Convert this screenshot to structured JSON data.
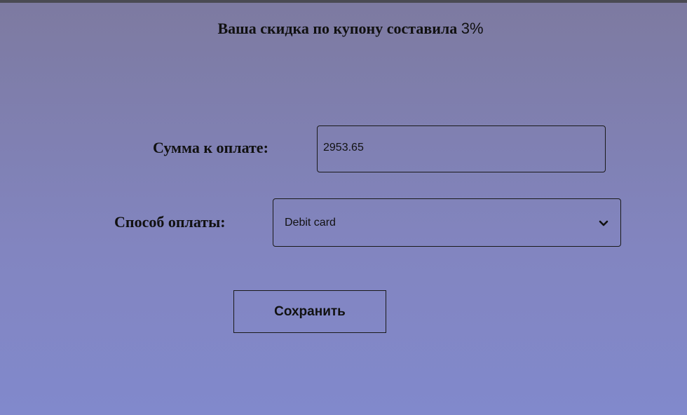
{
  "discount": {
    "text": "Ваша скидка по купону составила ",
    "percent": "3%"
  },
  "form": {
    "amount_label": "Сумма к оплате:",
    "amount_value": "2953.65",
    "method_label": "Способ оплаты:",
    "method_selected": "Debit card",
    "save_label": "Сохранить"
  },
  "icons": {
    "select_arrow": "chevron-down-icon"
  }
}
